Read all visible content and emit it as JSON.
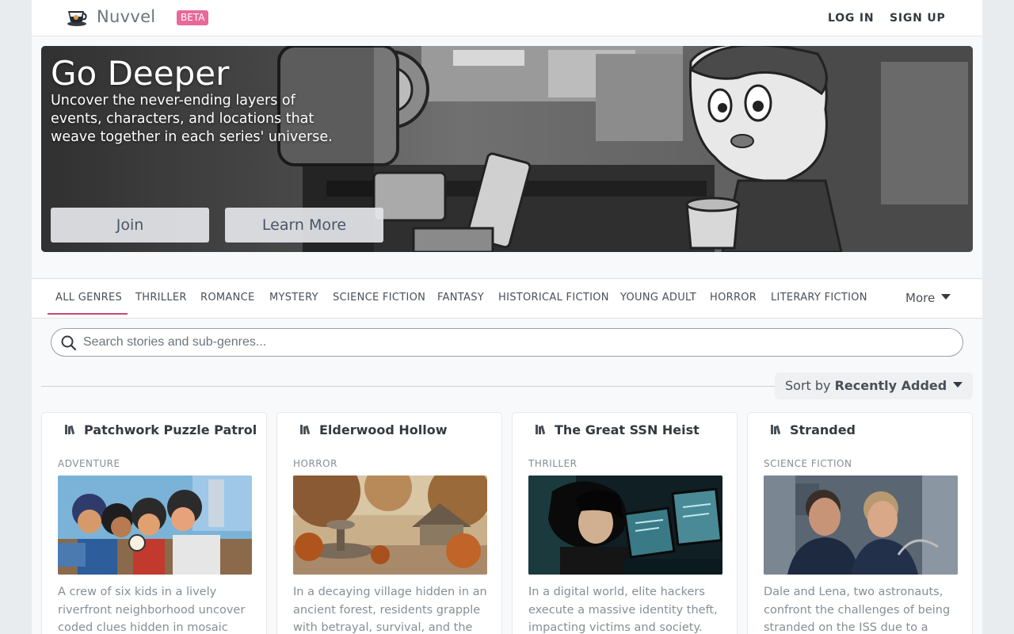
{
  "header": {
    "brand": "Nuvvel",
    "badge": "BETA",
    "login": "LOG IN",
    "signup": "SIGN UP"
  },
  "hero": {
    "title": "Go Deeper",
    "subtitle": "Uncover the never-ending layers of events, characters, and locations that weave together in each series' universe.",
    "join_label": "Join",
    "learn_label": "Learn More"
  },
  "genres": {
    "tabs": [
      "ALL GENRES",
      "THRILLER",
      "ROMANCE",
      "MYSTERY",
      "SCIENCE FICTION",
      "FANTASY",
      "HISTORICAL FICTION",
      "YOUNG ADULT",
      "HORROR",
      "LITERARY FICTION"
    ],
    "active": "ALL GENRES",
    "more_label": "More"
  },
  "search": {
    "placeholder": "Search stories and sub-genres..."
  },
  "sort": {
    "prefix": "Sort by",
    "value": "Recently Added"
  },
  "stories": [
    {
      "title": "Patchwork Puzzle Patrol",
      "genre": "ADVENTURE",
      "description": "A crew of six kids in a lively riverfront neighborhood uncover coded clues hidden in mosaic",
      "image_icon": "kids-puzzle-illustration"
    },
    {
      "title": "Elderwood Hollow",
      "genre": "HORROR",
      "description": "In a decaying village hidden in an ancient forest, residents grapple with betrayal, survival, and the",
      "image_icon": "autumn-village-fountain-illustration"
    },
    {
      "title": "The Great SSN Heist",
      "genre": "THRILLER",
      "description": "In a digital world, elite hackers execute a massive identity theft, impacting victims and society. The",
      "image_icon": "hacker-at-monitors-illustration"
    },
    {
      "title": "Stranded",
      "genre": "SCIENCE FICTION",
      "description": "Dale and Lena, two astronauts, confront the challenges of being stranded on the ISS due to a",
      "image_icon": "astronauts-in-station-photo"
    }
  ],
  "colors": {
    "accent": "#c84a73",
    "badge": "#e8699a"
  }
}
